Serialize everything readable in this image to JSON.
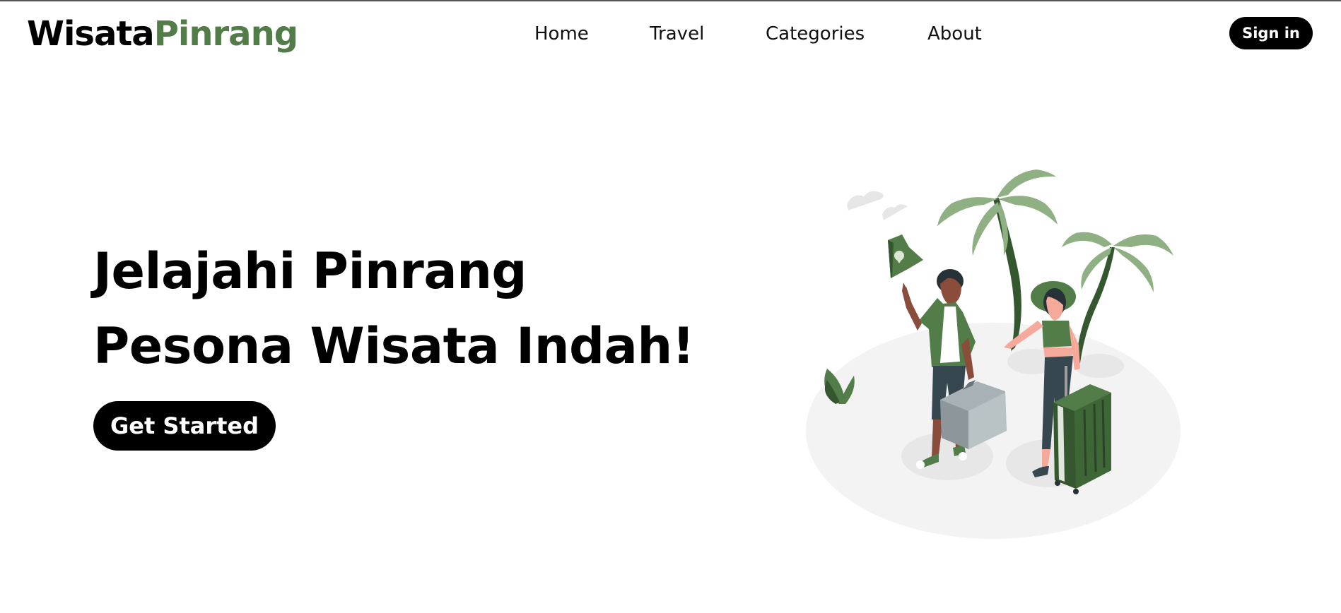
{
  "brand": {
    "part1": "Wisata",
    "part2": "Pinrang",
    "accent_color": "#527c48"
  },
  "nav": {
    "items": [
      "Home",
      "Travel",
      "Categories",
      "About"
    ]
  },
  "auth": {
    "signin_label": "Sign in"
  },
  "hero": {
    "line1": "Jelajahi Pinrang",
    "line2": "Pesona Wisata Indah!",
    "cta_label": "Get Started"
  },
  "colors": {
    "primary_green": "#527c48",
    "dark_green": "#35572f",
    "light_green": "#8fb082",
    "button_bg": "#000000"
  }
}
